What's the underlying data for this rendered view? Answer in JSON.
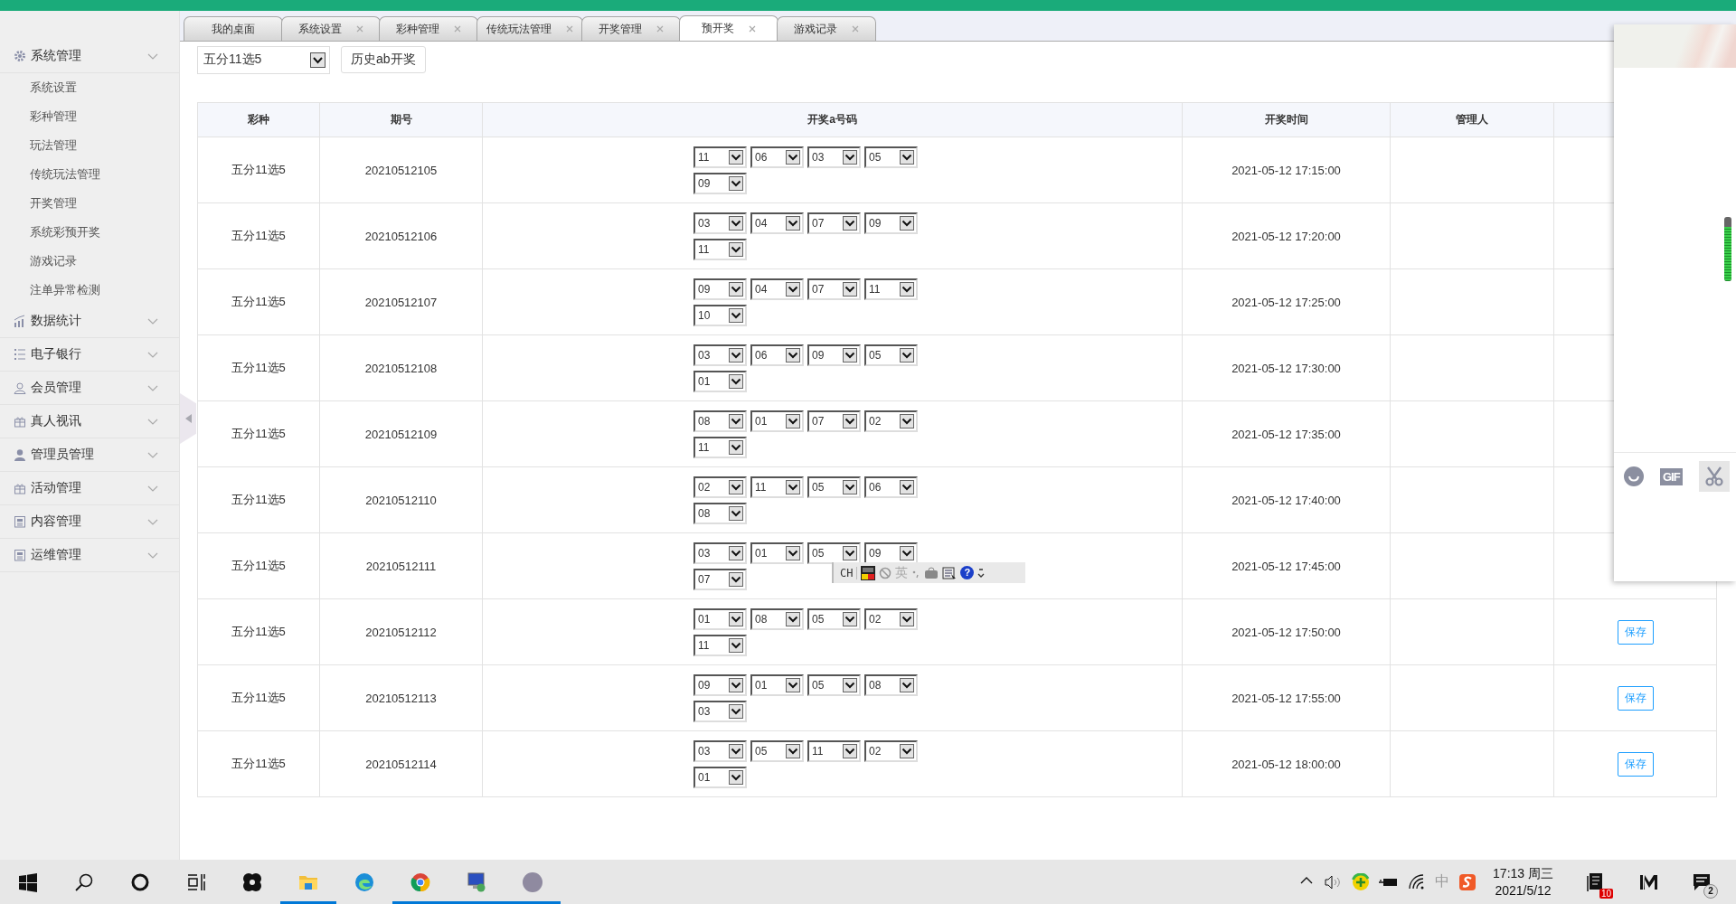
{
  "sidebar": {
    "groups": [
      {
        "label": "系统管理",
        "kind": "gear",
        "children": [
          "系统设置",
          "彩种管理",
          "玩法管理",
          "传统玩法管理",
          "开奖管理",
          "系统彩预开奖",
          "游戏记录",
          "注单异常检测"
        ]
      },
      {
        "label": "数据统计",
        "kind": "chart"
      },
      {
        "label": "电子银行",
        "kind": "list"
      },
      {
        "label": "会员管理",
        "kind": "user"
      },
      {
        "label": "真人视讯",
        "kind": "gift"
      },
      {
        "label": "管理员管理",
        "kind": "person"
      },
      {
        "label": "活动管理",
        "kind": "gift"
      },
      {
        "label": "内容管理",
        "kind": "doc"
      },
      {
        "label": "运维管理",
        "kind": "doc"
      }
    ]
  },
  "tabs": [
    {
      "label": "我的桌面",
      "closable": false,
      "selected": false
    },
    {
      "label": "系统设置",
      "closable": true,
      "selected": false
    },
    {
      "label": "彩种管理",
      "closable": true,
      "selected": false
    },
    {
      "label": "传统玩法管理",
      "closable": true,
      "selected": false
    },
    {
      "label": "开奖管理",
      "closable": true,
      "selected": false
    },
    {
      "label": "预开奖",
      "closable": true,
      "selected": true
    },
    {
      "label": "游戏记录",
      "closable": true,
      "selected": false
    }
  ],
  "toolbar": {
    "lottery_select": "五分11选5",
    "history_button": "历史ab开奖"
  },
  "table": {
    "columns": [
      "彩种",
      "期号",
      "开奖a号码",
      "开奖时间",
      "管理人"
    ],
    "rows": [
      {
        "lottery": "五分11选5",
        "period": "20210512105",
        "numbers": [
          "11",
          "06",
          "03",
          "05",
          "09"
        ],
        "time": "2021-05-12 17:15:00"
      },
      {
        "lottery": "五分11选5",
        "period": "20210512106",
        "numbers": [
          "03",
          "04",
          "07",
          "09",
          "11"
        ],
        "time": "2021-05-12 17:20:00"
      },
      {
        "lottery": "五分11选5",
        "period": "20210512107",
        "numbers": [
          "09",
          "04",
          "07",
          "11",
          "10"
        ],
        "time": "2021-05-12 17:25:00"
      },
      {
        "lottery": "五分11选5",
        "period": "20210512108",
        "numbers": [
          "03",
          "06",
          "09",
          "05",
          "01"
        ],
        "time": "2021-05-12 17:30:00"
      },
      {
        "lottery": "五分11选5",
        "period": "20210512109",
        "numbers": [
          "08",
          "01",
          "07",
          "02",
          "11"
        ],
        "time": "2021-05-12 17:35:00"
      },
      {
        "lottery": "五分11选5",
        "period": "20210512110",
        "numbers": [
          "02",
          "11",
          "05",
          "06",
          "08"
        ],
        "time": "2021-05-12 17:40:00"
      },
      {
        "lottery": "五分11选5",
        "period": "20210512111",
        "numbers": [
          "03",
          "01",
          "05",
          "09",
          "07"
        ],
        "time": "2021-05-12 17:45:00"
      },
      {
        "lottery": "五分11选5",
        "period": "20210512112",
        "numbers": [
          "01",
          "08",
          "05",
          "02",
          "11"
        ],
        "time": "2021-05-12 17:50:00",
        "action": "保存"
      },
      {
        "lottery": "五分11选5",
        "period": "20210512113",
        "numbers": [
          "09",
          "01",
          "05",
          "08",
          "03"
        ],
        "time": "2021-05-12 17:55:00",
        "action": "保存"
      },
      {
        "lottery": "五分11选5",
        "period": "20210512114",
        "numbers": [
          "03",
          "05",
          "11",
          "02",
          "01"
        ],
        "time": "2021-05-12 18:00:00",
        "action": "保存"
      }
    ]
  },
  "ime_toolbar": {
    "language": "CH",
    "mode": "英",
    "help": "?"
  },
  "chat_panel": {
    "mic_meter": {
      "level": 0.85
    },
    "gif_label": "GIF"
  },
  "taskbar": {
    "apps": [
      {
        "kind": "start",
        "running": false
      },
      {
        "kind": "search",
        "running": false
      },
      {
        "kind": "cortana",
        "running": false
      },
      {
        "kind": "taskview",
        "running": false
      },
      {
        "kind": "pinwheel",
        "running": false
      },
      {
        "kind": "folder",
        "running": true
      },
      {
        "kind": "edge",
        "running": false
      },
      {
        "kind": "chrome",
        "running": true
      },
      {
        "kind": "remote",
        "running": true
      },
      {
        "kind": "avatar",
        "running": true
      }
    ],
    "tray": [
      {
        "kind": "caret"
      },
      {
        "kind": "volume"
      },
      {
        "kind": "plus"
      },
      {
        "kind": "battery"
      },
      {
        "kind": "wifi"
      },
      {
        "kind": "ime",
        "text": "中"
      },
      {
        "kind": "sogou"
      }
    ],
    "clock": {
      "time": "17:13 周三",
      "date": "2021/5/12"
    },
    "right": [
      {
        "kind": "notes",
        "badge": "10"
      },
      {
        "kind": "logo"
      },
      {
        "kind": "chat",
        "badge": "2"
      }
    ]
  }
}
